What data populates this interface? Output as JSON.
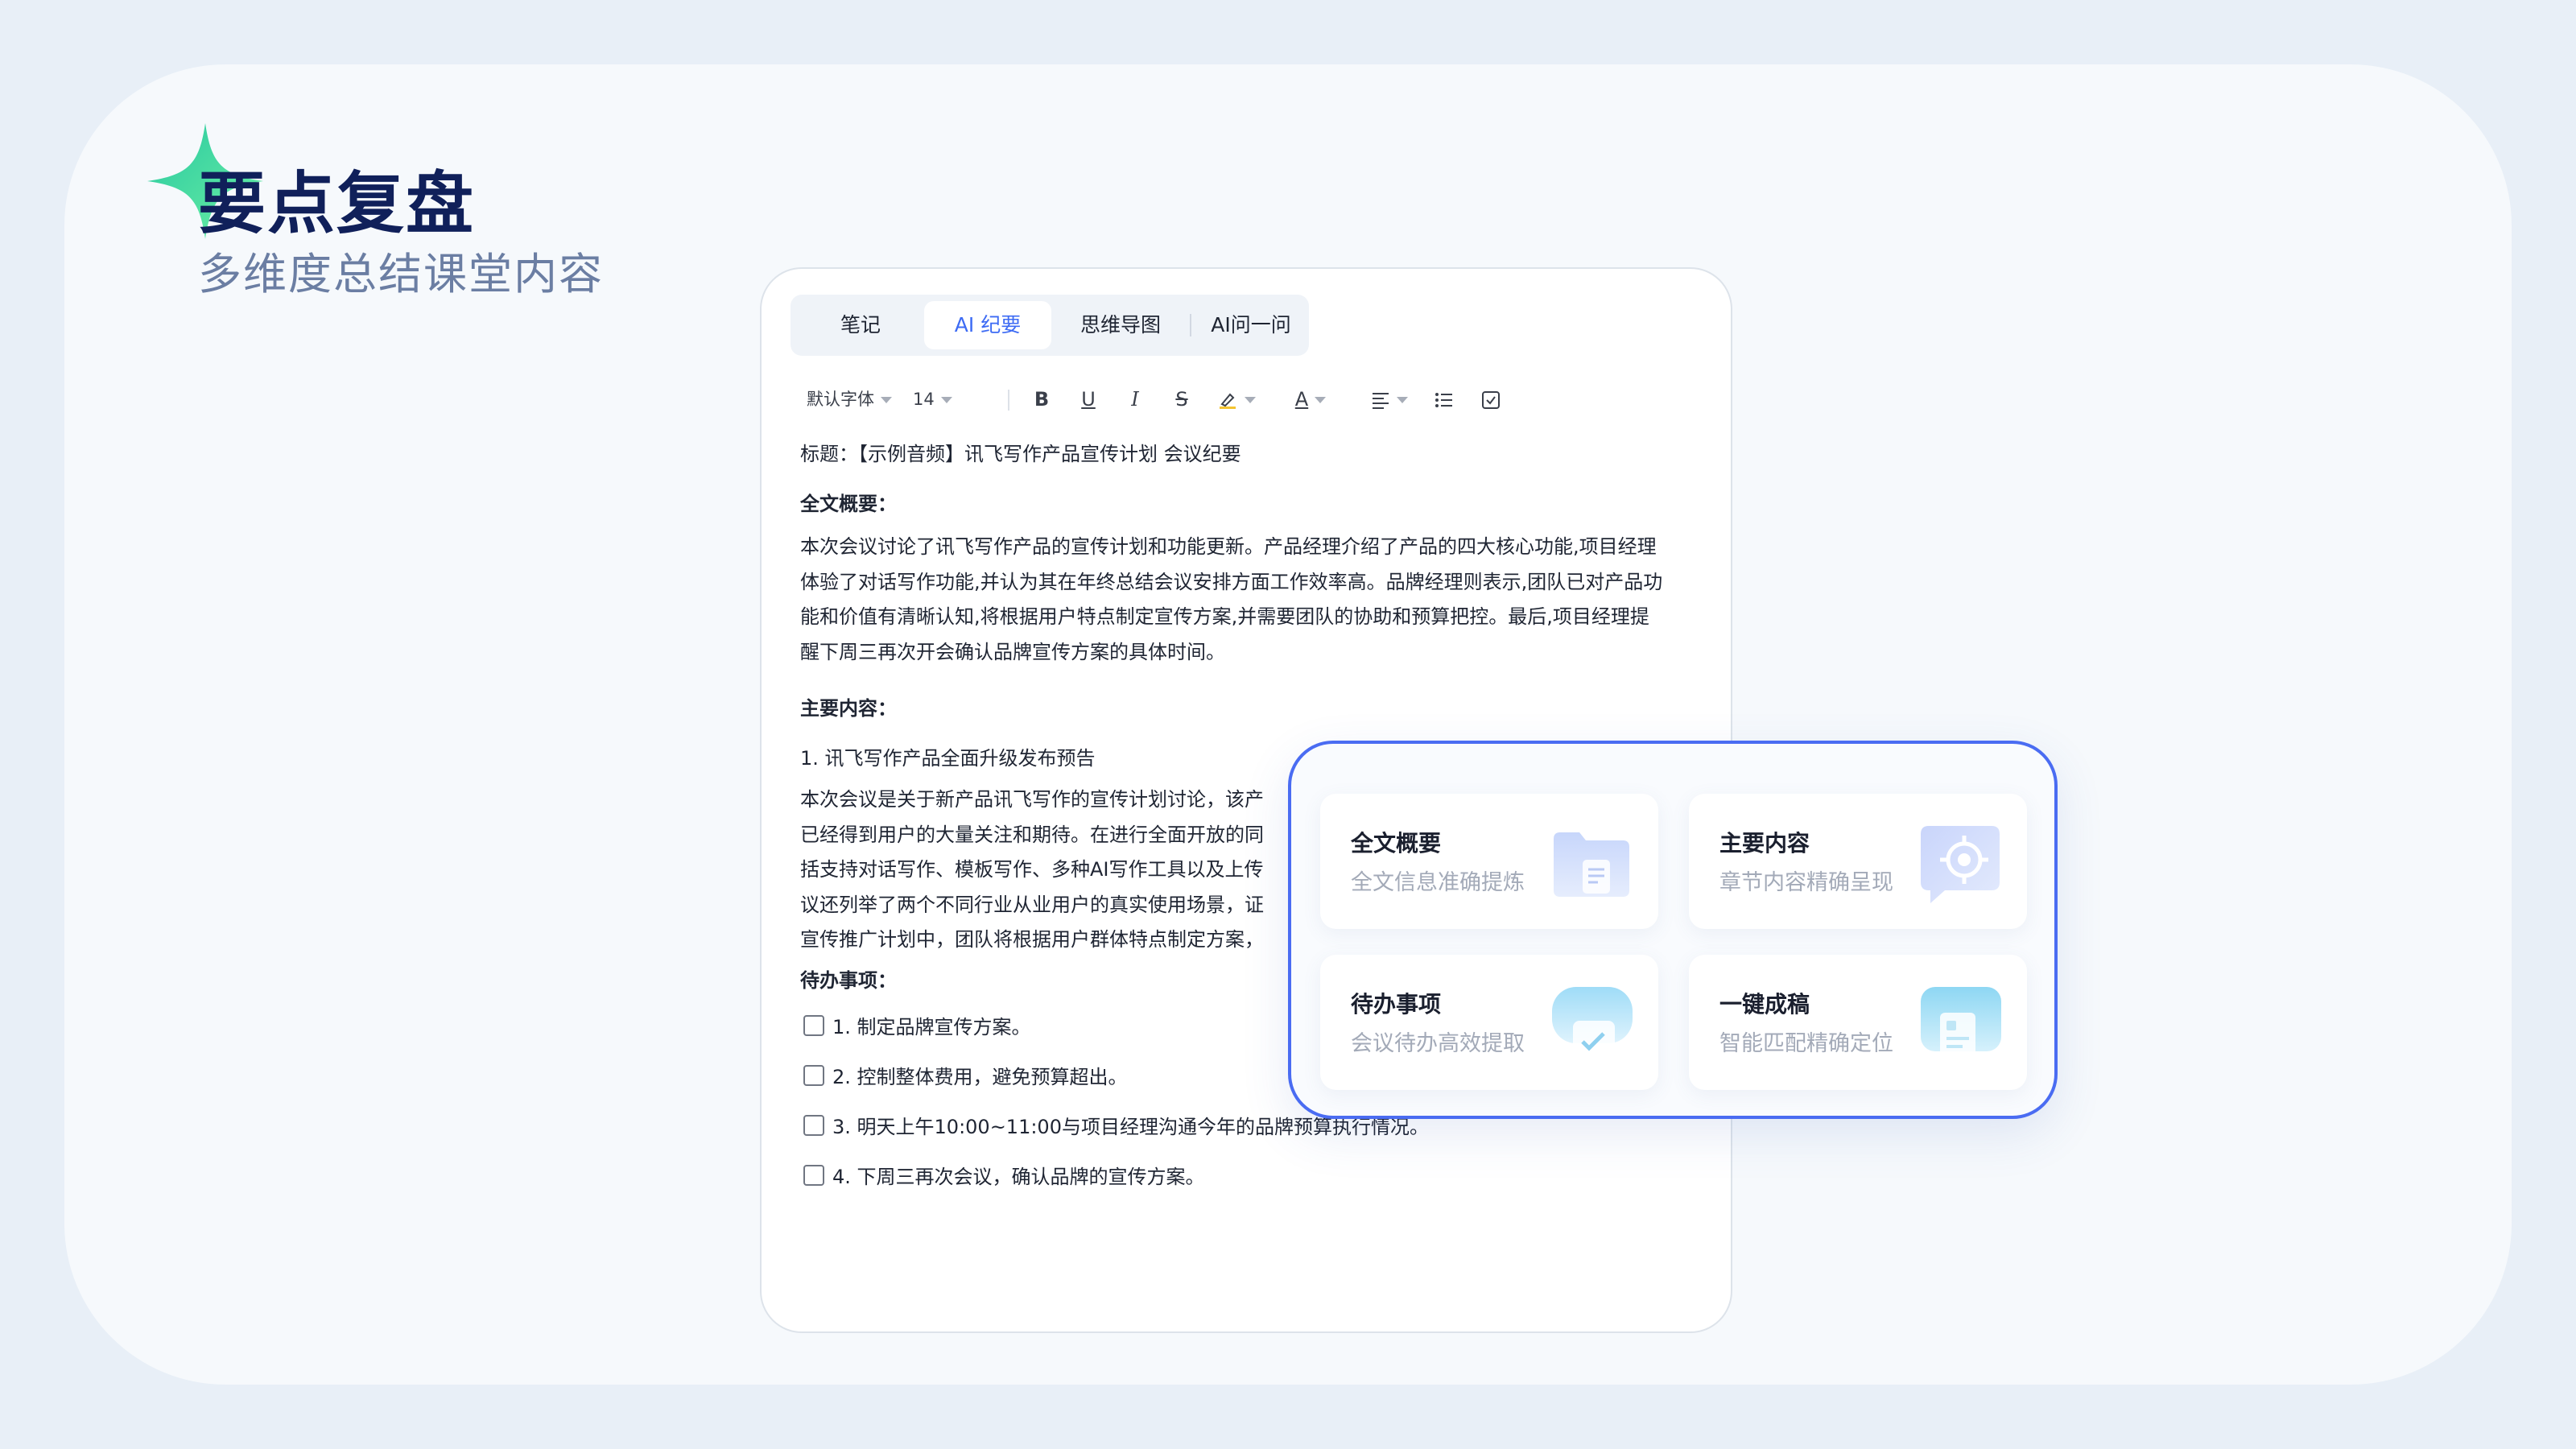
{
  "hero": {
    "title": "要点复盘",
    "subtitle": "多维度总结课堂内容"
  },
  "tabs": [
    {
      "label": "笔记"
    },
    {
      "label": "AI 纪要",
      "active": true
    },
    {
      "label": "思维导图"
    },
    {
      "label": "AI问一问"
    }
  ],
  "toolbar": {
    "font_family": "默认字体",
    "font_size": "14",
    "bold": "B",
    "underline": "U",
    "italic": "I",
    "strike": "S",
    "font_color": "A"
  },
  "document": {
    "title_line": "标题：【示例音频】讯飞写作产品宣传计划 会议纪要",
    "summary_heading": "全文概要：",
    "summary_lines": [
      "本次会议讨论了讯飞写作产品的宣传计划和功能更新。产品经理介绍了产品的四大核心功能,项目经理",
      "体验了对话写作功能,并认为其在年终总结会议安排方面工作效率高。品牌经理则表示,团队已对产品功",
      "能和价值有清晰认知,将根据用户特点制定宣传方案,并需要团队的协助和预算把控。最后,项目经理提",
      "醒下周三再次开会确认品牌宣传方案的具体时间。"
    ],
    "main_heading": "主要内容：",
    "section_1_title": "1. 讯飞写作产品全面升级发布预告",
    "section_1_lines": [
      "本次会议是关于新产品讯飞写作的宣传计划讨论，该产",
      "已经得到用户的大量关注和期待。在进行全面开放的同",
      "括支持对话写作、模板写作、多种AI写作工具以及上传",
      "议还列举了两个不同行业从业用户的真实使用场景，证",
      "宣传推广计划中，团队将根据用户群体特点制定方案，"
    ],
    "todo_heading": "待办事项：",
    "todos": [
      "1. 制定品牌宣传方案。",
      "2. 控制整体费用，避免预算超出。",
      "3. 明天上午10:00~11:00与项目经理沟通今年的品牌预算执行情况。",
      "4. 下周三再次会议，确认品牌的宣传方案。"
    ]
  },
  "features": [
    {
      "title": "全文概要",
      "subtitle": "全文信息准确提炼",
      "icon": "folder-document-icon"
    },
    {
      "title": "主要内容",
      "subtitle": "章节内容精确呈现",
      "icon": "target-chat-icon"
    },
    {
      "title": "待办事项",
      "subtitle": "会议待办高效提取",
      "icon": "checkmark-chat-icon"
    },
    {
      "title": "一键成稿",
      "subtitle": "智能匹配精确定位",
      "icon": "document-draft-icon"
    }
  ],
  "colors": {
    "accent": "#3d6bf4",
    "overlay_border": "#4a6cf2",
    "headline": "#10205a",
    "sparkle": "#3ddc9a"
  }
}
